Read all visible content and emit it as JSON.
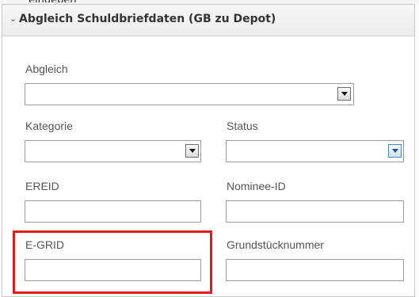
{
  "panel": {
    "title": "Abgleich Schuldbriefdaten (GB zu Depot)",
    "collapse_icon": "chevron-down-icon"
  },
  "top_snippet": "eingeben",
  "fields": {
    "abgleich": {
      "label": "Abgleich",
      "value": ""
    },
    "kategorie": {
      "label": "Kategorie",
      "value": ""
    },
    "status": {
      "label": "Status",
      "value": ""
    },
    "ereid": {
      "label": "EREID",
      "value": ""
    },
    "nominee_id": {
      "label": "Nominee-ID",
      "value": ""
    },
    "egrid": {
      "label": "E-GRID",
      "value": ""
    },
    "grundstuecknummer": {
      "label": "Grundstücknummer",
      "value": ""
    }
  },
  "colors": {
    "highlight": "#e01c1c",
    "panel_border": "#c9c9c9",
    "focus_blue": "#4d87c7"
  }
}
